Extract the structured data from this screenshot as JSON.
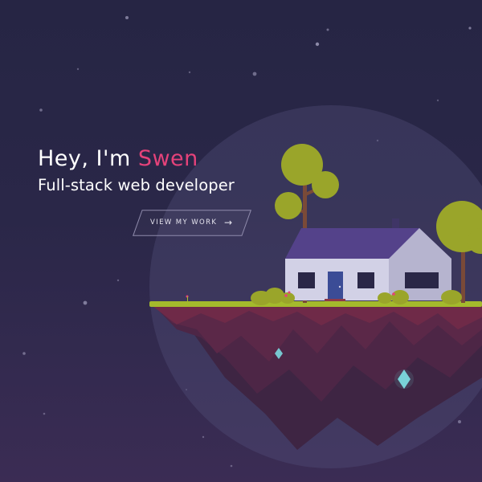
{
  "hero": {
    "greeting_prefix": "Hey, I'm ",
    "greeting_name": "Swen",
    "tagline": "Full-stack web developer",
    "cta_label": "VIEW MY WORK",
    "cta_arrow": "→"
  },
  "icons": {
    "cta_arrow": "arrow-right-icon"
  },
  "colors": {
    "background_top": "#262544",
    "background_bottom": "#3b2c54",
    "accent": "#e5427a",
    "text": "#ffffff",
    "grass": "#a4ba2c",
    "island_top": "#6f2a48",
    "island_dark": "#3c2440",
    "crystal": "#7fe3e8",
    "tree_foliage": "#9aa52a",
    "tree_trunk": "#7a4a38",
    "roof": "#54428a",
    "house_wall": "#d2d1e6"
  }
}
